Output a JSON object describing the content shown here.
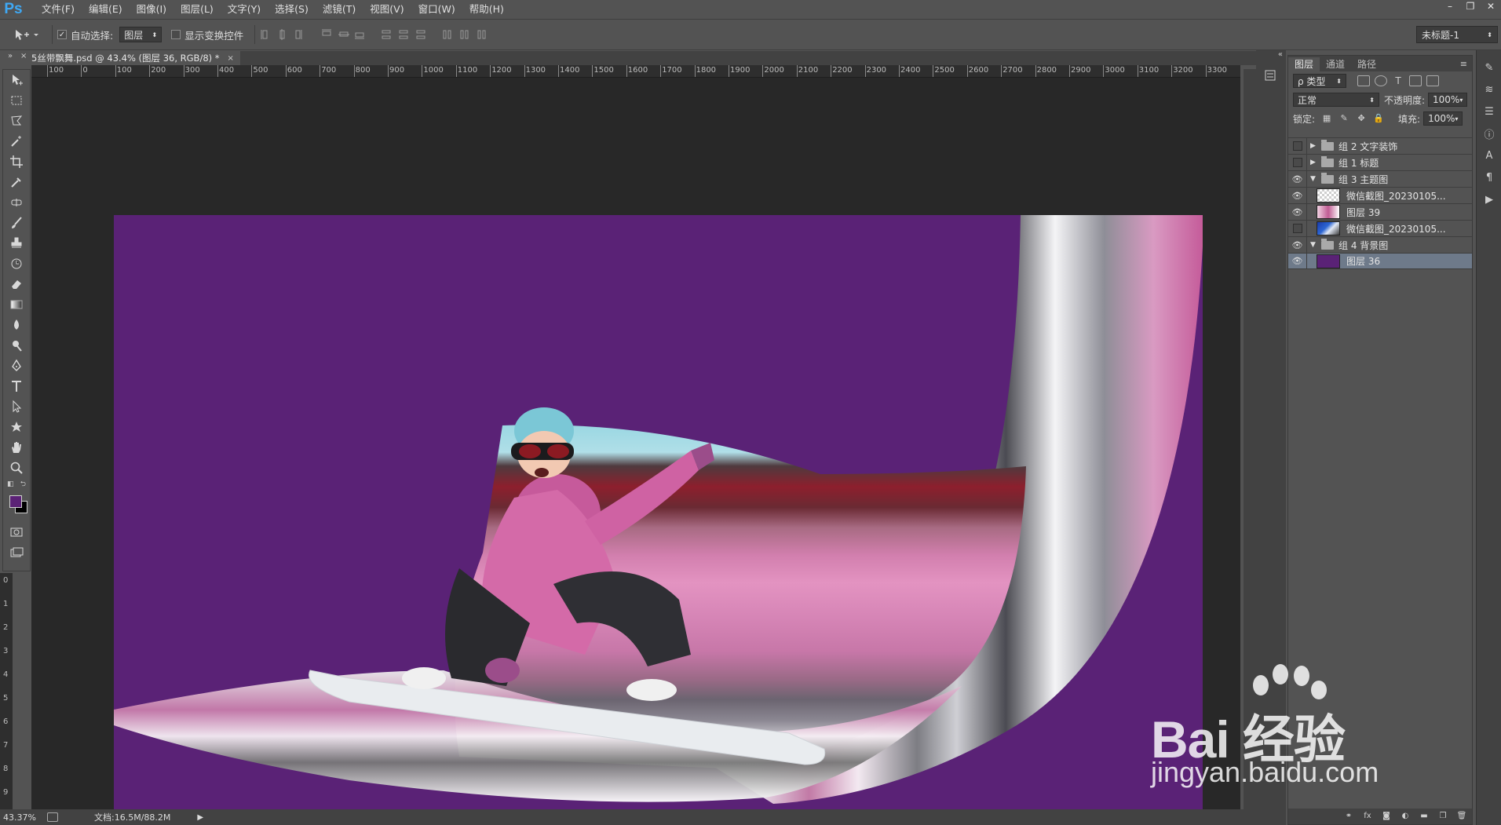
{
  "app": {
    "logo": "Ps"
  },
  "menu": [
    "文件(F)",
    "编辑(E)",
    "图像(I)",
    "图层(L)",
    "文字(Y)",
    "选择(S)",
    "滤镜(T)",
    "视图(V)",
    "窗口(W)",
    "帮助(H)"
  ],
  "window_controls": [
    "–",
    "❐",
    "✕"
  ],
  "options": {
    "auto_select_label": "自动选择:",
    "auto_select_checked": true,
    "auto_select_target": "图层",
    "show_transform_label": "显示变换控件",
    "workspace": "未标题-1"
  },
  "document": {
    "tab_title": "5丝带飘舞.psd @ 43.4% (图层 36, RGB/8) *",
    "tab_close": "×"
  },
  "ruler_h": [
    "100",
    "0",
    "100",
    "200",
    "300",
    "400",
    "500",
    "600",
    "700",
    "800",
    "900",
    "1000",
    "1100",
    "1200",
    "1300",
    "1400",
    "1500",
    "1600",
    "1700",
    "1800",
    "1900",
    "2000",
    "2100",
    "2200",
    "2300",
    "2400",
    "2500",
    "2600",
    "2700",
    "2800",
    "2900",
    "3000",
    "3100",
    "3200",
    "3300"
  ],
  "ruler_v": [
    "0",
    "1",
    "2",
    "3",
    "4",
    "5",
    "6",
    "7",
    "8",
    "9"
  ],
  "status": {
    "zoom": "43.37%",
    "doc_size": "文档:16.5M/88.2M",
    "arrow": "▶"
  },
  "colors": {
    "foreground": "#5a2276",
    "background": "#000000",
    "canvas_bg": "#5a2276"
  },
  "layers_panel": {
    "tabs": [
      "图层",
      "通道",
      "路径"
    ],
    "filter_kind": "ρ 类型",
    "blend_mode": "正常",
    "opacity_label": "不透明度:",
    "opacity": "100%",
    "lock_label": "锁定:",
    "fill_label": "填充:",
    "fill": "100%",
    "layers": [
      {
        "name": "组 2 文字装饰",
        "type": "group",
        "visible": false,
        "expanded": false,
        "indent": 0
      },
      {
        "name": "组 1 标题",
        "type": "group",
        "visible": false,
        "expanded": false,
        "indent": 0
      },
      {
        "name": "组 3 主题图",
        "type": "group",
        "visible": true,
        "expanded": true,
        "indent": 0
      },
      {
        "name": "微信截图_20230105...",
        "type": "layer",
        "visible": true,
        "thumb": "checker",
        "indent": 1
      },
      {
        "name": "图层 39",
        "type": "layer",
        "visible": true,
        "thumb": "pinkscene",
        "indent": 1
      },
      {
        "name": "微信截图_20230105...",
        "type": "layer",
        "visible": false,
        "thumb": "bluephoto",
        "indent": 1
      },
      {
        "name": "组 4 背景图",
        "type": "group",
        "visible": true,
        "expanded": true,
        "indent": 0
      },
      {
        "name": "图层 36",
        "type": "layer",
        "visible": true,
        "thumb": "purple",
        "indent": 1,
        "selected": true
      }
    ]
  },
  "watermark": {
    "brand": "Bai  经验",
    "url": "jingyan.baidu.com"
  }
}
